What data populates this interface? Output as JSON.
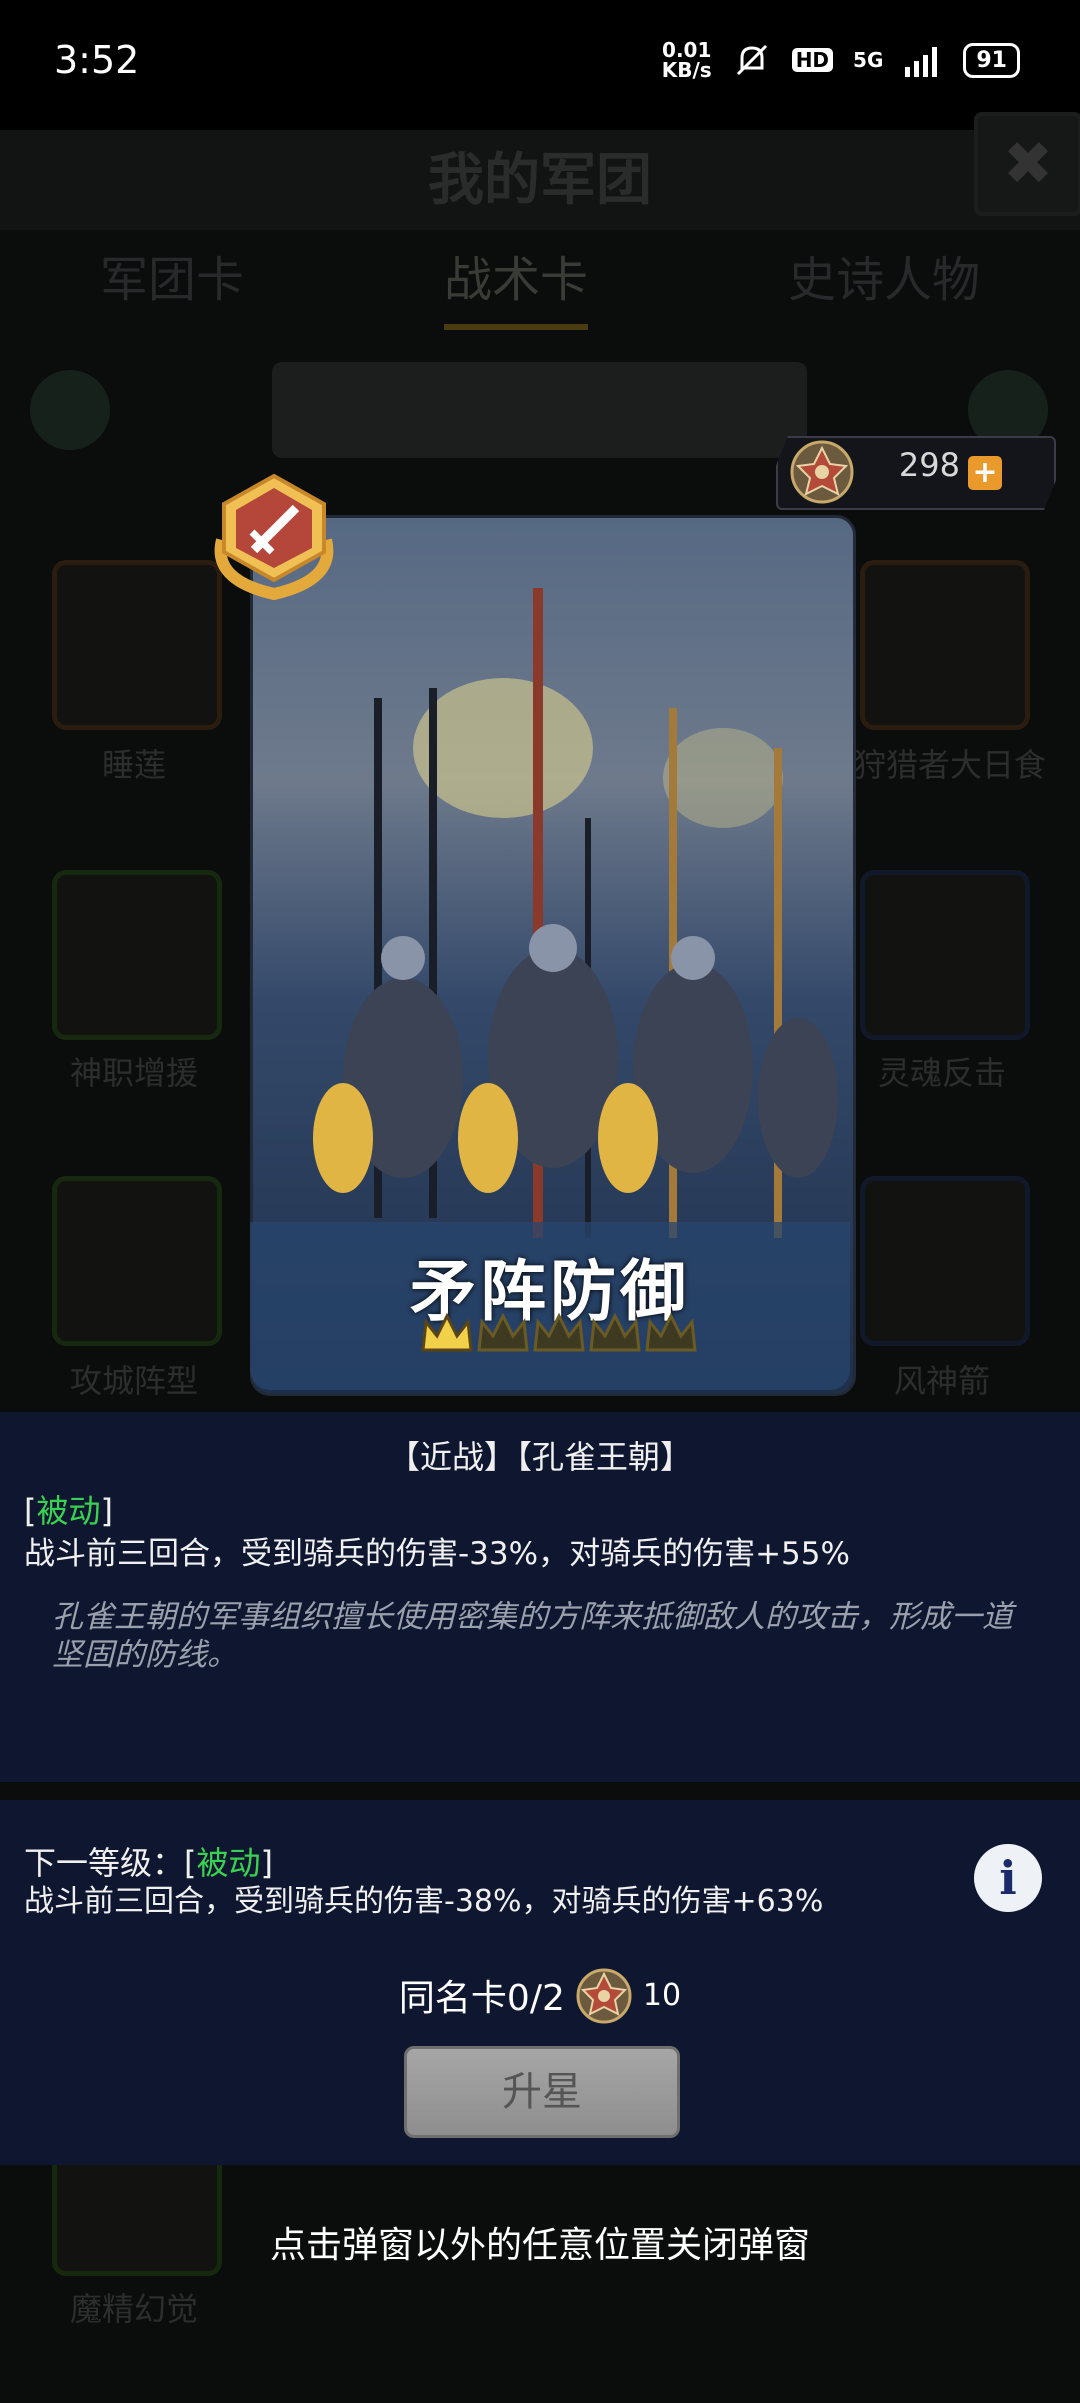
{
  "status_bar": {
    "time": "3:52",
    "net_speed_value": "0.01",
    "net_speed_unit": "KB/s",
    "hd_label": "HD",
    "network_label": "5G",
    "battery": "91"
  },
  "background": {
    "title": "我的军团",
    "close_symbol": "✖",
    "tabs": [
      {
        "label": "军团卡"
      },
      {
        "label": "战术卡"
      },
      {
        "label": "史诗人物"
      }
    ],
    "cards": [
      {
        "label": "睡莲"
      },
      {
        "label": "狩猎者大日食"
      },
      {
        "label": "神职增援"
      },
      {
        "label": "灵魂反击"
      },
      {
        "label": "攻城阵型"
      },
      {
        "label": "风神箭"
      },
      {
        "label": "魔精幻觉"
      }
    ]
  },
  "currency": {
    "value": "298",
    "plus_symbol": "+",
    "icon": "emblem-icon"
  },
  "card": {
    "name": "矛阵防御",
    "star_level": 1,
    "star_max": 5,
    "badge_icon": "sword-badge-icon"
  },
  "detail": {
    "tags": "【近战】【孔雀王朝】",
    "passive_open": "[",
    "passive_label": "被动",
    "passive_close": "]",
    "effect": "战斗前三回合，受到骑兵的伤害-33%，对骑兵的伤害+55%",
    "flavor": "孔雀王朝的军事组织擅长使用密集的方阵来抵御敌人的攻击，形成一道坚固的防线。"
  },
  "next_level": {
    "prefix": "下一等级：[",
    "passive_label": "被动",
    "suffix": "]",
    "effect": "战斗前三回合，受到骑兵的伤害-38%，对骑兵的伤害+63%",
    "info_symbol": "i"
  },
  "upgrade": {
    "duplicate_label": "同名卡0/2",
    "cost": "10",
    "button_label": "升星"
  },
  "hint": "点击弹窗以外的任意位置关闭弹窗",
  "colors": {
    "passive_green": "#39d152",
    "panel_bg": "#0f1730",
    "plus_orange": "#e99a2b",
    "crown_gold": "#f2d14a"
  }
}
